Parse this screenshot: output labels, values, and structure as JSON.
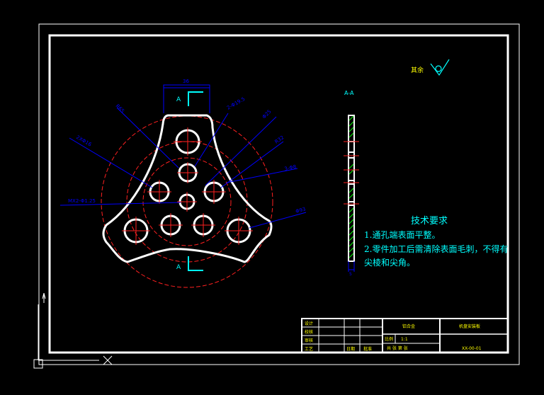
{
  "drawing": {
    "finish_label": "其余",
    "section_label": "A-A",
    "view_marker_top": "A",
    "view_marker_bottom": "A",
    "tech_requirements": {
      "heading": "技术要求",
      "line1": "1.通孔端表面平整。",
      "line2a": "2.零件加工后需清除表面毛刺，不得有",
      "line2b": "尖棱和尖角。"
    },
    "dimensions": {
      "top_width": "36",
      "d1": "R65",
      "d2": "2-Φ19.5",
      "d3": "Φ25",
      "d4": "R32",
      "d5": "3-Φ8",
      "d6": "2XΦ16",
      "d7": "Φ93",
      "d8": "MX2-Φ1.25",
      "thickness": "5"
    }
  },
  "title_block": {
    "designer_label": "设计",
    "checker_label": "校核",
    "approver_label": "审核",
    "process_label": "工艺",
    "approve_label": "批准",
    "date_label": "日期",
    "material": "铝合金",
    "ratio_label": "比例",
    "ratio_value": "1:1",
    "sheet_info": "共 张 第 张",
    "part_name": "机盘安装板",
    "drawing_no": "XX-00-01"
  },
  "colors": {
    "background": "#000000",
    "outline": "#ffffff",
    "dimension": "#0000ff",
    "centerline": "#ff0000",
    "text": "#00ffff",
    "title_text": "#ffff00"
  }
}
